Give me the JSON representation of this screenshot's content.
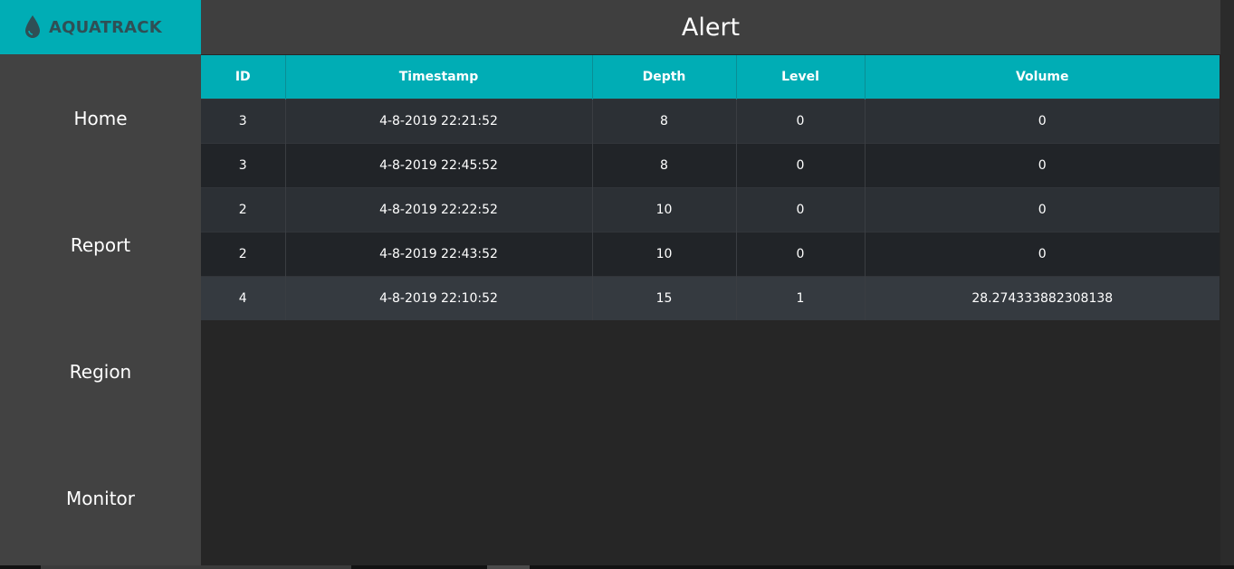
{
  "brand": {
    "name": "AQUATRACK",
    "icon": "water-drop-icon"
  },
  "nav": [
    {
      "label": "Home"
    },
    {
      "label": "Report"
    },
    {
      "label": "Region"
    },
    {
      "label": "Monitor"
    }
  ],
  "header": {
    "title": "Alert"
  },
  "table": {
    "columns": [
      "ID",
      "Timestamp",
      "Depth",
      "Level",
      "Volume"
    ],
    "rows": [
      [
        "3",
        "4-8-2019 22:21:52",
        "8",
        "0",
        "0"
      ],
      [
        "3",
        "4-8-2019 22:45:52",
        "8",
        "0",
        "0"
      ],
      [
        "2",
        "4-8-2019 22:22:52",
        "10",
        "0",
        "0"
      ],
      [
        "2",
        "4-8-2019 22:43:52",
        "10",
        "0",
        "0"
      ],
      [
        "4",
        "4-8-2019 22:10:52",
        "15",
        "1",
        "28.274333882308138"
      ]
    ]
  },
  "colors": {
    "accent": "#00adb5",
    "sidebar": "#424242",
    "header": "#3f3f3f",
    "background": "#262626"
  }
}
